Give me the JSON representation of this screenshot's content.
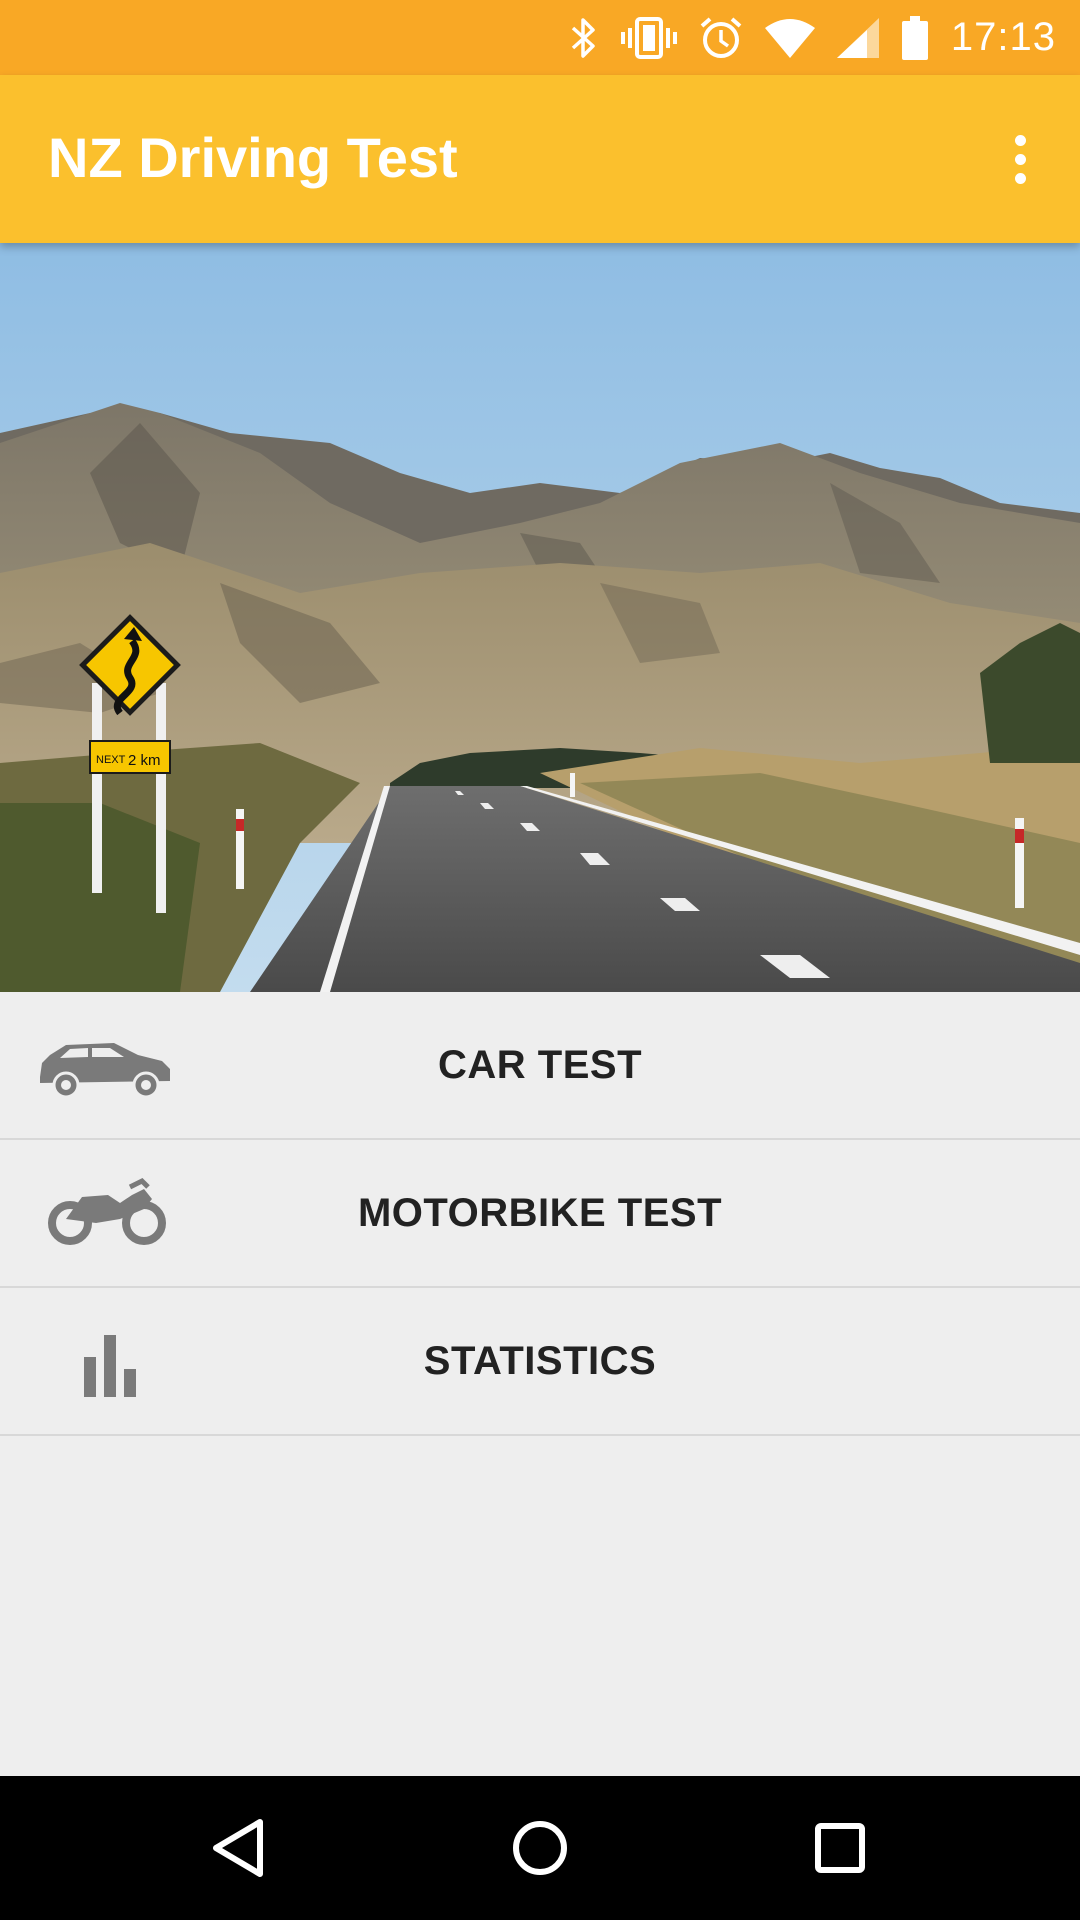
{
  "status_bar": {
    "time": "17:13",
    "icons": [
      "bluetooth-icon",
      "vibrate-icon",
      "alarm-icon",
      "wifi-icon",
      "signal-icon",
      "battery-icon"
    ],
    "color": "#f9a825"
  },
  "app_bar": {
    "title": "NZ Driving Test",
    "color": "#fbc02d",
    "menu_icon": "more-vert-icon"
  },
  "hero": {
    "sign_text_next": "NEXT",
    "sign_text_distance": "2 km"
  },
  "menu": {
    "items": [
      {
        "label": "CAR TEST",
        "icon": "car-icon"
      },
      {
        "label": "MOTORBIKE TEST",
        "icon": "motorbike-icon"
      },
      {
        "label": "STATISTICS",
        "icon": "bar-chart-icon"
      }
    ]
  },
  "nav_bar": {
    "buttons": [
      "back-icon",
      "home-icon",
      "recents-icon"
    ]
  }
}
